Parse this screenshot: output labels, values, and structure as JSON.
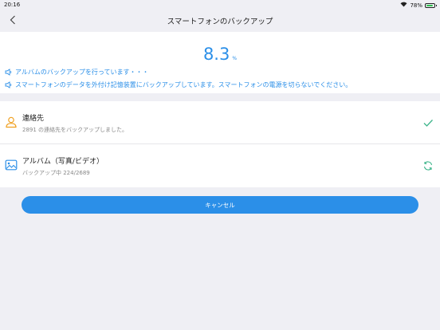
{
  "status": {
    "time": "20:16",
    "battery": "78%"
  },
  "nav": {
    "title": "スマートフォンのバックアップ"
  },
  "progress": {
    "value": "8.3",
    "unit": "%",
    "message1": "アルバムのバックアップを行っています・・・",
    "message2": "スマートフォンのデータを外付け記憶装置にバックアップしています。スマートフォンの電源を切らないでください。"
  },
  "items": [
    {
      "name": "連絡先",
      "status": "2891 の連絡先をバックアップしました。",
      "icon": "contact-icon",
      "state_icon": "checkmark-icon"
    },
    {
      "name": "アルバム（写真/ビデオ）",
      "status": "バックアップ中 224/2689",
      "icon": "photo-album-icon",
      "state_icon": "sync-icon"
    }
  ],
  "actions": {
    "cancel_label": "キャンセル"
  },
  "colors": {
    "accent": "#2b8fe8",
    "check": "#3cb48a",
    "contact_icon": "#f0a020",
    "album_icon": "#2b8fe8"
  }
}
